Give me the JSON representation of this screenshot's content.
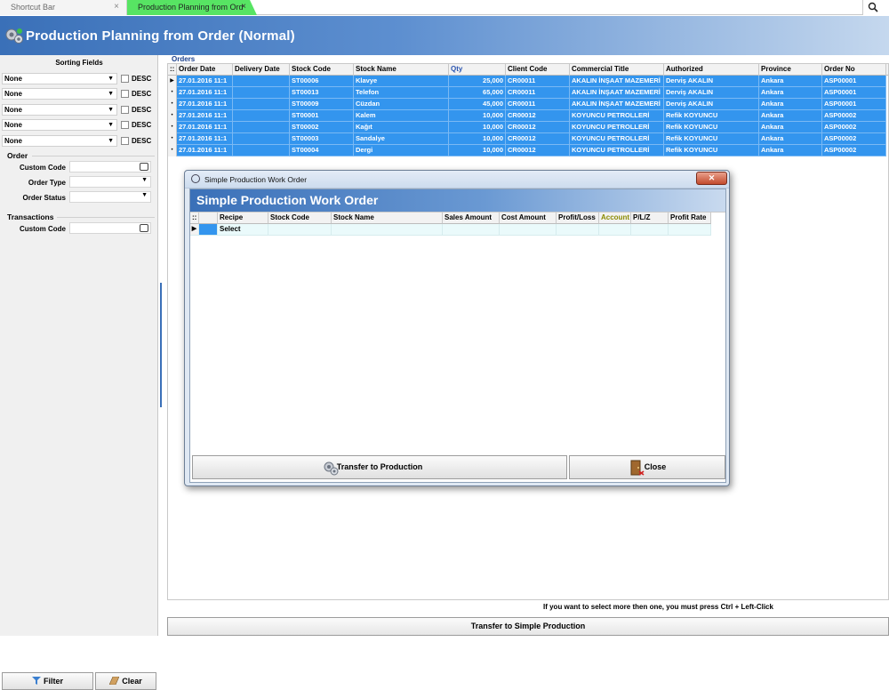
{
  "tabs": [
    {
      "label": "Shortcut Bar",
      "close": "×"
    },
    {
      "label": "Production Planning from Ord",
      "close": "×"
    }
  ],
  "top_search_icon": "search-icon",
  "header": {
    "title": "Production Planning from Order (Normal)"
  },
  "sidebar": {
    "sorting_title": "Sorting Fields",
    "sort_rows": [
      {
        "value": "None",
        "desc": "DESC"
      },
      {
        "value": "None",
        "desc": "DESC"
      },
      {
        "value": "None",
        "desc": "DESC"
      },
      {
        "value": "None",
        "desc": "DESC"
      },
      {
        "value": "None",
        "desc": "DESC"
      }
    ],
    "order_group": "Order",
    "custom_code_label": "Custom Code",
    "order_type_label": "Order Type",
    "order_status_label": "Order Status",
    "transactions_group": "Transactions",
    "trans_custom_code_label": "Custom Code",
    "filter_button": "Filter",
    "clear_button": "Clear"
  },
  "orders": {
    "label": "Orders",
    "columns": [
      "Order Date",
      "Delivery Date",
      "Stock Code",
      "Stock Name",
      "Qty",
      "Client Code",
      "Commercial Title",
      "Authorized",
      "Province",
      "Order No"
    ],
    "rows": [
      [
        "27.01.2016 11:1",
        "",
        "ST00006",
        "Klavye",
        "25,000",
        "CR00011",
        "AKALIN İNŞAAT MAZEMERİ",
        "Derviş AKALIN",
        "Ankara",
        "ASP00001"
      ],
      [
        "27.01.2016 11:1",
        "",
        "ST00013",
        "Telefon",
        "65,000",
        "CR00011",
        "AKALIN İNŞAAT MAZEMERİ",
        "Derviş AKALIN",
        "Ankara",
        "ASP00001"
      ],
      [
        "27.01.2016 11:1",
        "",
        "ST00009",
        "Cüzdan",
        "45,000",
        "CR00011",
        "AKALIN İNŞAAT MAZEMERİ",
        "Derviş AKALIN",
        "Ankara",
        "ASP00001"
      ],
      [
        "27.01.2016 11:1",
        "",
        "ST00001",
        "Kalem",
        "10,000",
        "CR00012",
        "KOYUNCU PETROLLERİ",
        "Refik KOYUNCU",
        "Ankara",
        "ASP00002"
      ],
      [
        "27.01.2016 11:1",
        "",
        "ST00002",
        "Kağıt",
        "10,000",
        "CR00012",
        "KOYUNCU PETROLLERİ",
        "Refik KOYUNCU",
        "Ankara",
        "ASP00002"
      ],
      [
        "27.01.2016 11:1",
        "",
        "ST00003",
        "Sandalye",
        "10,000",
        "CR00012",
        "KOYUNCU PETROLLERİ",
        "Refik KOYUNCU",
        "Ankara",
        "ASP00002"
      ],
      [
        "27.01.2016 11:1",
        "",
        "ST00004",
        "Dergi",
        "10,000",
        "CR00012",
        "KOYUNCU PETROLLERİ",
        "Refik KOYUNCU",
        "Ankara",
        "ASP00002"
      ]
    ],
    "footnote": "If you want to select more then one, you must press Ctrl + Left-Click",
    "transfer_button": "Transfer to Simple Production"
  },
  "dialog": {
    "window_title": "Simple Production Work Order",
    "close_x": "✕",
    "header": "Simple Production Work Order",
    "columns": [
      "Recipe",
      "Stock Code",
      "Stock Name",
      "Sales Amount",
      "Cost Amount",
      "Profit/Loss",
      "Account",
      "P/L/Z",
      "Profit Rate"
    ],
    "account_color": "#8a8a00",
    "row": {
      "recipe": "Select"
    },
    "transfer_button": "Transfer to Production",
    "close_button": "Close"
  }
}
